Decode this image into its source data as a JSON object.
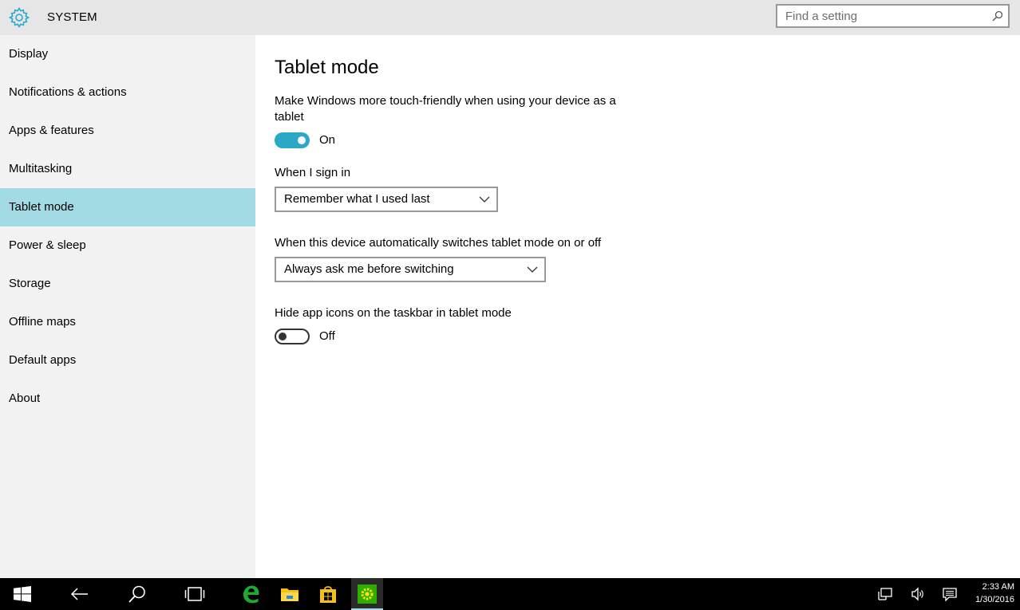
{
  "window": {
    "title": "SYSTEM"
  },
  "search": {
    "placeholder": "Find a setting"
  },
  "sidebar": {
    "items": [
      {
        "label": "Display"
      },
      {
        "label": "Notifications & actions"
      },
      {
        "label": "Apps & features"
      },
      {
        "label": "Multitasking"
      },
      {
        "label": "Tablet mode"
      },
      {
        "label": "Power & sleep"
      },
      {
        "label": "Storage"
      },
      {
        "label": "Offline maps"
      },
      {
        "label": "Default apps"
      },
      {
        "label": "About"
      }
    ],
    "active_item": "Tablet mode"
  },
  "main": {
    "title": "Tablet mode",
    "touch_friendly": {
      "label": "Make Windows more touch-friendly when using your device as a tablet",
      "state": "On"
    },
    "sign_in": {
      "label": "When I sign in",
      "value": "Remember what I used last"
    },
    "auto_switch": {
      "label": "When this device automatically switches tablet mode on or off",
      "value": "Always ask me before switching"
    },
    "hide_icons": {
      "label": "Hide app icons on the taskbar in tablet mode",
      "state": "Off"
    }
  },
  "taskbar": {
    "time": "2:33 AM",
    "date": "1/30/2016"
  },
  "colors": {
    "accent": "#29a9c6",
    "sidebar_active": "#a3dbe5",
    "sidebar_bg": "#f2f2f2",
    "titlebar_bg": "#e6e6e6",
    "taskbar_bg": "#000000"
  }
}
